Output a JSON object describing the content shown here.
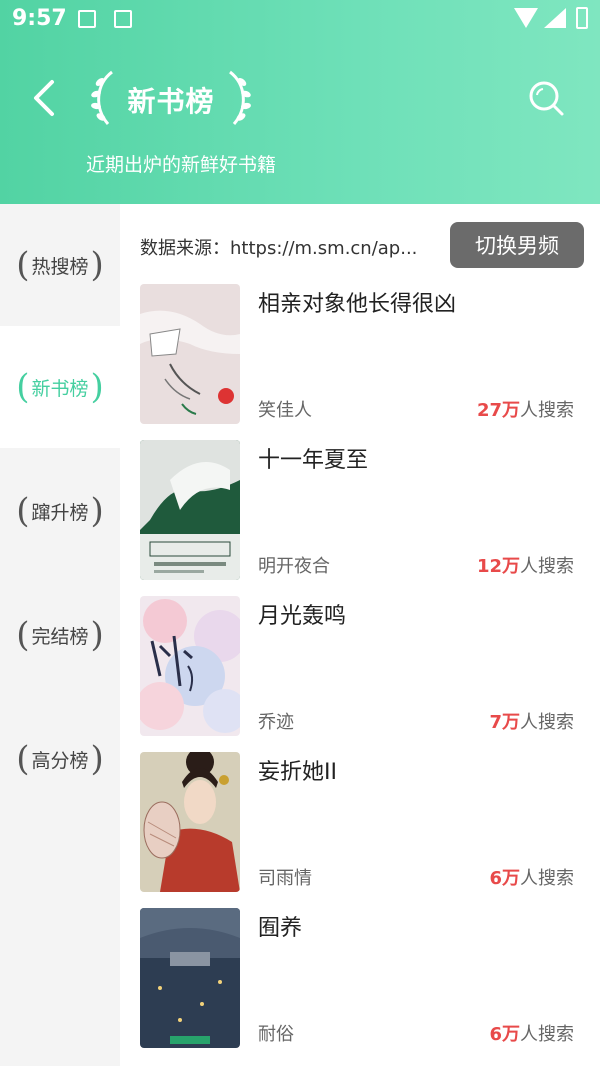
{
  "status_bar": {
    "time": "9:57"
  },
  "header": {
    "title": "新书榜",
    "subtitle": "近期出炉的新鲜好书籍"
  },
  "sidebar": {
    "items": [
      {
        "label": "热搜榜",
        "active": false
      },
      {
        "label": "新书榜",
        "active": true
      },
      {
        "label": "蹿升榜",
        "active": false
      },
      {
        "label": "完结榜",
        "active": false
      },
      {
        "label": "高分榜",
        "active": false
      }
    ]
  },
  "content": {
    "source_text": "数据来源：https://m.sm.cn/ap...",
    "switch_label": "切换男频",
    "search_suffix": "人搜索",
    "books": [
      {
        "title": "相亲对象他长得很凶",
        "author": "笑佳人",
        "count": "27万"
      },
      {
        "title": "十一年夏至",
        "author": "明开夜合",
        "count": "12万"
      },
      {
        "title": "月光轰鸣",
        "author": "乔迹",
        "count": "7万"
      },
      {
        "title": "妄折她II",
        "author": "司雨情",
        "count": "6万"
      },
      {
        "title": "囿养",
        "author": "耐俗",
        "count": "6万"
      }
    ]
  },
  "colors": {
    "accent": "#45cfa0",
    "search_count": "#e84a4a",
    "switch_button": "#6b6b6b"
  }
}
